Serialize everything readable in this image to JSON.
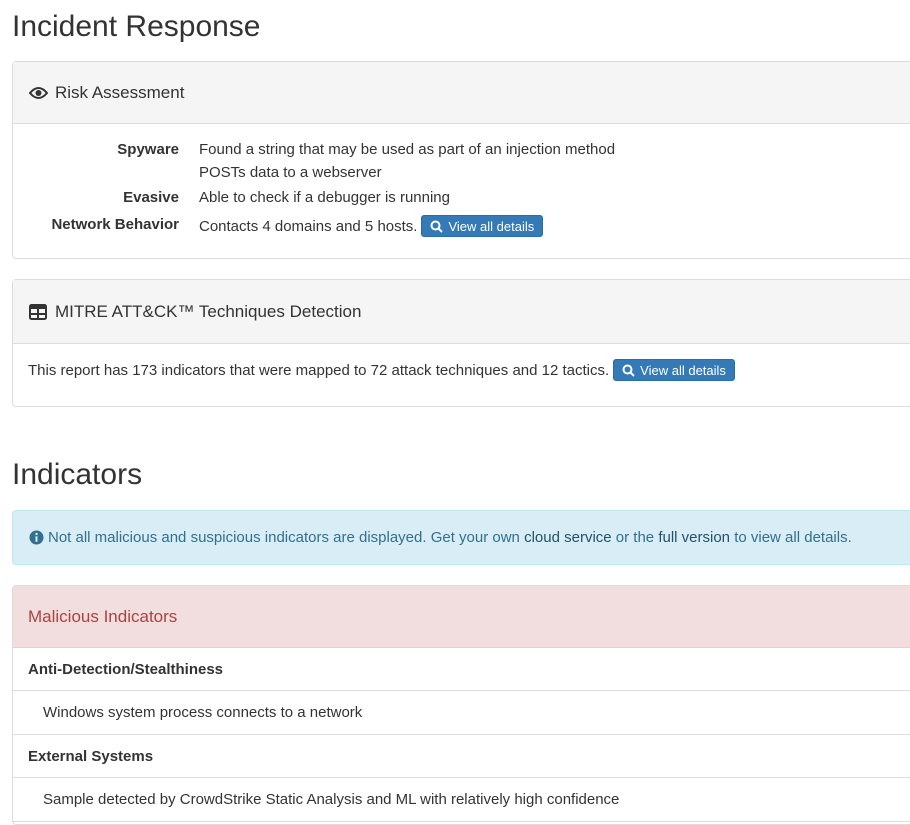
{
  "page_title": "Incident Response",
  "risk": {
    "heading": "Risk Assessment",
    "rows": [
      {
        "label": "Spyware",
        "values": [
          "Found a string that may be used as part of an injection method",
          "POSTs data to a webserver"
        ]
      },
      {
        "label": "Evasive",
        "values": [
          "Able to check if a debugger is running"
        ]
      },
      {
        "label": "Network Behavior",
        "values": [
          "Contacts 4 domains and 5 hosts."
        ]
      }
    ],
    "button": "View all details"
  },
  "mitre": {
    "heading": "MITRE ATT&CK™ Techniques Detection",
    "text": "This report has 173 indicators that were mapped to 72 attack techniques and 12 tactics.",
    "button": "View all details"
  },
  "indicators": {
    "title": "Indicators",
    "alert": {
      "prefix": "Not all malicious and suspicious indicators are displayed. Get your own",
      "link1": "cloud service",
      "middle": "or the",
      "link2": "full version",
      "suffix": "to view all details."
    },
    "malicious": {
      "heading": "Malicious Indicators",
      "categories": [
        {
          "name": "Anti-Detection/Stealthiness",
          "items": [
            "Windows system process connects to a network"
          ]
        },
        {
          "name": "External Systems",
          "items": [
            "Sample detected by CrowdStrike Static Analysis and ML with relatively high confidence"
          ]
        }
      ]
    }
  },
  "colors": {
    "primary": "#337ab7",
    "danger_bg": "#f2dede",
    "danger_text": "#a94442",
    "info_bg": "#d9edf7",
    "info_text": "#31708f"
  }
}
